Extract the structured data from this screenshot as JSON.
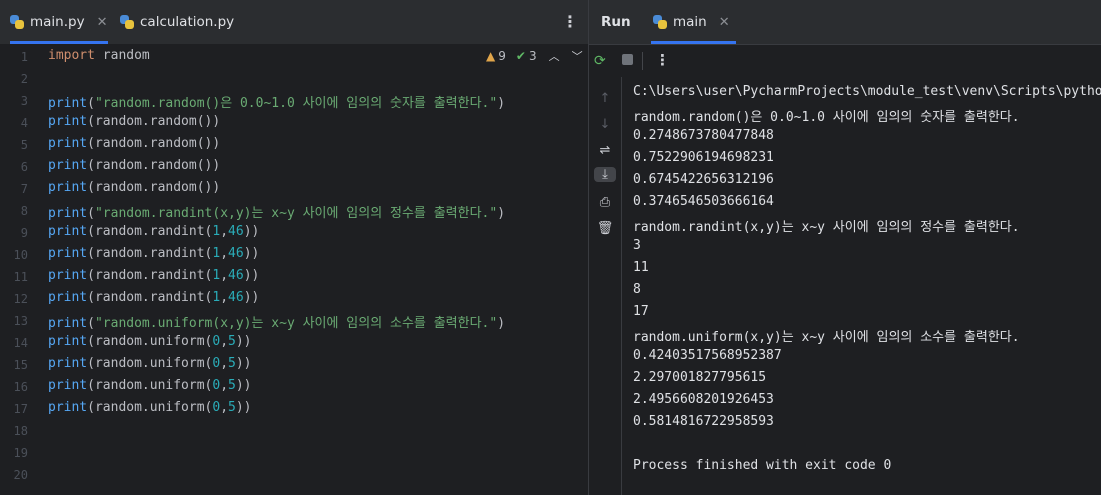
{
  "editor": {
    "tabs": [
      {
        "label": "main.py",
        "close": "✕"
      },
      {
        "label": "calculation.py"
      }
    ],
    "more": "⋮",
    "inspections": {
      "warnings": "9",
      "ok": "3"
    },
    "line_numbers": [
      "1",
      "2",
      "3",
      "4",
      "5",
      "6",
      "7",
      "8",
      "9",
      "10",
      "11",
      "12",
      "13",
      "14",
      "15",
      "16",
      "17",
      "18",
      "19",
      "20"
    ],
    "code": {
      "l1_kw": "import",
      "l1_rest": " random",
      "p": "print",
      "rr": "(random.random())",
      "l3_str": "\"random.random()은 0.0~1.0 사이에 임의의 숫자를 출력한다.\"",
      "l8_str": "\"random.randint(x,y)는 x~y 사이에 임의의 정수를 출력한다.\"",
      "l13_str": "\"random.uniform(x,y)는 x~y 사이에 임의의 소수를 출력한다.\"",
      "ri": "(random.randint(",
      "ru": "(random.uniform(",
      "a1": "1",
      "a46": "46",
      "a0": "0",
      "a5": "5",
      "comma": ",",
      "close2": "))",
      "open": "(",
      "close": ")"
    }
  },
  "run": {
    "title": "Run",
    "tab_label": "main",
    "tab_close": "✕",
    "more": "⋮",
    "output": [
      "C:\\Users\\user\\PycharmProjects\\module_test\\venv\\Scripts\\python.exe",
      "random.random()은 0.0~1.0 사이에 임의의 숫자를 출력한다.",
      "0.2748673780477848",
      "0.7522906194698231",
      "0.6745422656312196",
      "0.3746546503666164",
      "random.randint(x,y)는 x~y 사이에 임의의 정수를 출력한다.",
      "3",
      "11",
      "8",
      "17",
      "random.uniform(x,y)는 x~y 사이에 임의의 소수를 출력한다.",
      "0.42403517568952387",
      "2.297001827795615",
      "2.4956608201926453",
      "0.5814816722958593",
      "",
      "Process finished with exit code 0"
    ]
  }
}
